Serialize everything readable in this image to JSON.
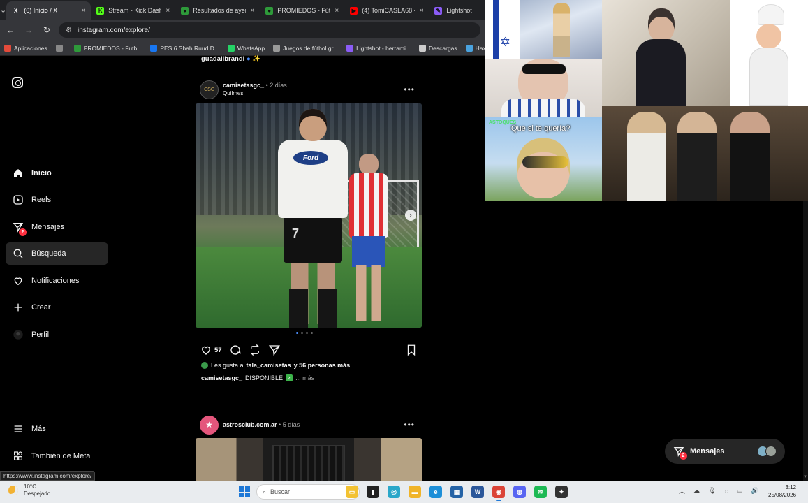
{
  "browser": {
    "tabs": [
      {
        "title": "(6) Inicio / X",
        "icon": "x-icon",
        "color": "#111111",
        "glyph": "X",
        "active": true
      },
      {
        "title": "Stream - Kick Dashb",
        "icon": "kick-icon",
        "color": "#53fc18",
        "glyph": "K",
        "active": false
      },
      {
        "title": "Resultados de ayer",
        "icon": "promiedos-icon",
        "color": "#2e9a3a",
        "glyph": "●",
        "active": false
      },
      {
        "title": "PROMIEDOS - Fútb",
        "icon": "promiedos-icon",
        "color": "#2e9a3a",
        "glyph": "●",
        "active": false
      },
      {
        "title": "(4) TomiCASLA68 -",
        "icon": "youtube-icon",
        "color": "#ff0000",
        "glyph": "▶",
        "active": false
      },
      {
        "title": "Lightshot",
        "icon": "lightshot-icon",
        "color": "#8b5cf6",
        "glyph": "✎",
        "active": false
      }
    ],
    "url": "instagram.com/explore/",
    "bookmarks": [
      {
        "label": "Aplicaciones",
        "icon": "apps-icon",
        "color": "#e34b3b"
      },
      {
        "label": "",
        "icon": "grid-icon",
        "color": "#888888"
      },
      {
        "label": "PROMIEDOS - Futb...",
        "icon": "promiedos-icon",
        "color": "#2e9a3a"
      },
      {
        "label": "PES 6 Shah Ruud D...",
        "icon": "facebook-icon",
        "color": "#1877f2"
      },
      {
        "label": "WhatsApp",
        "icon": "whatsapp-icon",
        "color": "#25d366"
      },
      {
        "label": "Juegos de fútbol gr...",
        "icon": "gamepad-icon",
        "color": "#999999"
      },
      {
        "label": "Lightshot - herrami...",
        "icon": "lightshot-icon",
        "color": "#8b5cf6"
      },
      {
        "label": "Descargas",
        "icon": "download-icon",
        "color": "#cccccc"
      },
      {
        "label": "Hax",
        "icon": "hax-icon",
        "color": "#4aa3df"
      }
    ],
    "status_url": "https://www.instagram.com/explore/"
  },
  "sidebar": {
    "items": [
      {
        "label": "Inicio",
        "icon": "home-icon",
        "bold": true
      },
      {
        "label": "Reels",
        "icon": "reels-icon",
        "bold": false
      },
      {
        "label": "Mensajes",
        "icon": "messenger-icon",
        "bold": false,
        "badge": "2"
      },
      {
        "label": "Búsqueda",
        "icon": "search-icon",
        "bold": false,
        "selected": true
      },
      {
        "label": "Notificaciones",
        "icon": "heart-icon",
        "bold": false
      },
      {
        "label": "Crear",
        "icon": "plus-icon",
        "bold": false
      },
      {
        "label": "Perfil",
        "icon": "profile-avatar",
        "bold": false
      }
    ],
    "bottom": [
      {
        "label": "Más",
        "icon": "menu-icon"
      },
      {
        "label": "También de Meta",
        "icon": "meta-icon"
      }
    ]
  },
  "feed": {
    "previous_user": "guadalibrandi",
    "post1": {
      "username": "camisetasgc_",
      "time": "2 días",
      "location": "Quilmes",
      "avatar_text": "CSC",
      "likes_count": "57",
      "likes_line_prefix": "Les gusta a",
      "likes_user": "tala_camisetas",
      "likes_line_suffix": "y 56 personas más",
      "caption_user": "camisetasgc_",
      "caption_text": "DISPONIBLE",
      "caption_more": "... más",
      "shirt_sponsor": "Ford",
      "shirt_number": "7",
      "carousel_total": 4,
      "carousel_index": 1
    },
    "post2": {
      "username": "astrosclub.com.ar",
      "time": "5 días",
      "avatar_icon": "star-icon"
    }
  },
  "messages_pill": {
    "label": "Mensajes",
    "badge": "2"
  },
  "overlay": {
    "astoques_tag": "ASTOQUES",
    "astoques_caption": "Que si te quería?"
  },
  "taskbar": {
    "weather_temp": "10°C",
    "weather_desc": "Despejado",
    "search_placeholder": "Buscar",
    "time": "3:12",
    "date": "25/08/2026",
    "apps": [
      {
        "icon": "file-explorer-icon",
        "color": "#f3c232",
        "glyph": "▭"
      },
      {
        "icon": "terminal-icon",
        "color": "#222222",
        "glyph": "▮"
      },
      {
        "icon": "copilot-icon",
        "color": "#2aa7c9",
        "glyph": "◎"
      },
      {
        "icon": "folder-icon",
        "color": "#f0b429",
        "glyph": "▬"
      },
      {
        "icon": "edge-icon",
        "color": "#1d8fd8",
        "glyph": "e"
      },
      {
        "icon": "store-icon",
        "color": "#2563a6",
        "glyph": "▦"
      },
      {
        "icon": "word-icon",
        "color": "#2b579a",
        "glyph": "W"
      },
      {
        "icon": "chrome-icon",
        "color": "#db4437",
        "glyph": "◉",
        "active": true
      },
      {
        "icon": "discord-icon",
        "color": "#5865f2",
        "glyph": "◍"
      },
      {
        "icon": "spotify-icon",
        "color": "#1db954",
        "glyph": "≋"
      },
      {
        "icon": "game-icon",
        "color": "#333333",
        "glyph": "✦"
      }
    ]
  }
}
